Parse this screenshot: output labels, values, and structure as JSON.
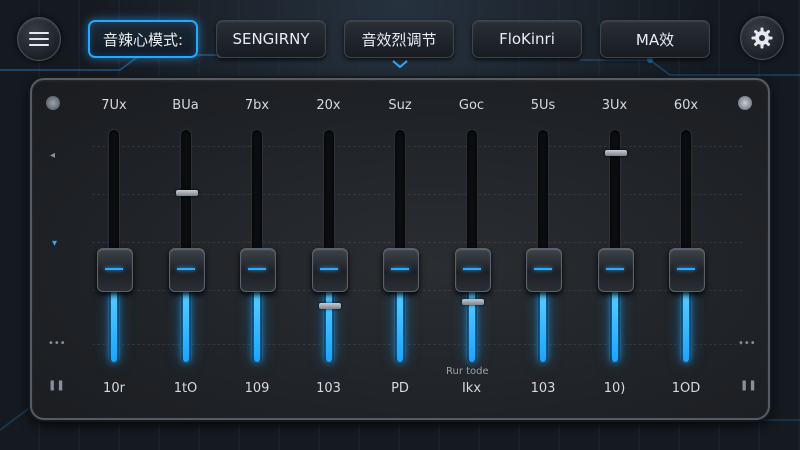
{
  "header": {
    "tabs": [
      {
        "label": "音辣心模式:",
        "active": true
      },
      {
        "label": "SENGIRNY",
        "active": false
      },
      {
        "label": "音效烈调节",
        "active": false
      },
      {
        "label": "FloKinri",
        "active": false
      },
      {
        "label": "MA效",
        "active": false
      }
    ]
  },
  "equalizer": {
    "bands": [
      {
        "label": "7Ux",
        "value": "10r",
        "level": 0.4,
        "aux_level": 0.37
      },
      {
        "label": "BUa",
        "value": "1tO",
        "level": 0.4,
        "aux_level": 0.73
      },
      {
        "label": "7bx",
        "value": "109",
        "level": 0.4,
        "aux_level": 0.38
      },
      {
        "label": "20x",
        "value": "103",
        "level": 0.4,
        "aux_level": 0.24
      },
      {
        "label": "Suz",
        "value": "PD",
        "level": 0.4,
        "aux_level": null
      },
      {
        "label": "Goc",
        "value": "Ikx",
        "level": 0.4,
        "aux_level": 0.26
      },
      {
        "label": "5Us",
        "value": "103",
        "level": 0.4,
        "aux_level": null
      },
      {
        "label": "3Ux",
        "value": "10)",
        "level": 0.4,
        "aux_level": 0.9
      },
      {
        "label": "60x",
        "value": "1OD",
        "level": 0.4,
        "aux_level": null
      }
    ],
    "mode_label": "Rur tode"
  },
  "colors": {
    "accent": "#1aa4ff",
    "panel": "#1f2226",
    "text": "#d6dae0"
  }
}
